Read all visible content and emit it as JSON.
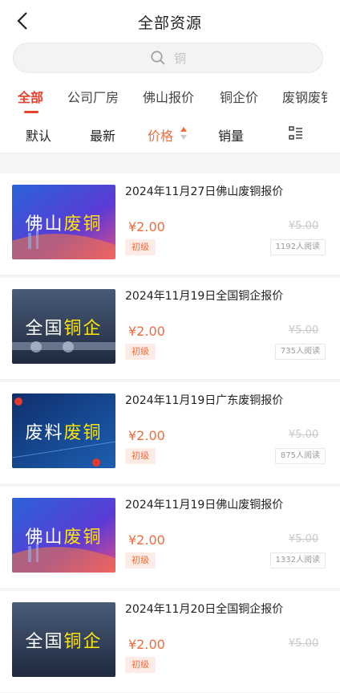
{
  "header": {
    "title": "全部资源",
    "back_label": "<"
  },
  "search": {
    "placeholder": "铜"
  },
  "tabs": [
    {
      "label": "全部",
      "active": true
    },
    {
      "label": "公司厂房",
      "active": false
    },
    {
      "label": "佛山报价",
      "active": false
    },
    {
      "label": "铜企价",
      "active": false
    },
    {
      "label": "废钢废钅",
      "active": false
    }
  ],
  "sort": {
    "default": "默认",
    "newest": "最新",
    "price": "价格",
    "sales": "销量"
  },
  "items": [
    {
      "title": "2024年11月27日佛山废铜报价",
      "price": "¥2.00",
      "original_price": "¥5.00",
      "level": "初级",
      "reads": "1192人阅读",
      "thumb_white": "佛山",
      "thumb_yellow": "废铜",
      "theme": "blue"
    },
    {
      "title": "2024年11月19日全国铜企报价",
      "price": "¥2.00",
      "original_price": "¥5.00",
      "level": "初级",
      "reads": "735人阅读",
      "thumb_white": "全国",
      "thumb_yellow": "铜企",
      "theme": "gray"
    },
    {
      "title": "2024年11月19日广东废铜报价",
      "price": "¥2.00",
      "original_price": "¥5.00",
      "level": "初级",
      "reads": "875人阅读",
      "thumb_white": "废料",
      "thumb_yellow": "废铜",
      "theme": "navy"
    },
    {
      "title": "2024年11月19日佛山废铜报价",
      "price": "¥2.00",
      "original_price": "¥5.00",
      "level": "初级",
      "reads": "1332人阅读",
      "thumb_white": "佛山",
      "thumb_yellow": "废铜",
      "theme": "blue"
    },
    {
      "title": "2024年11月20日全国铜企报价",
      "price": "¥2.00",
      "original_price": "¥5.00",
      "level": "初级",
      "reads": "",
      "thumb_white": "全国",
      "thumb_yellow": "铜企",
      "theme": "gray"
    }
  ],
  "colors": {
    "accent": "#e5402c",
    "price": "#f26b3a"
  }
}
